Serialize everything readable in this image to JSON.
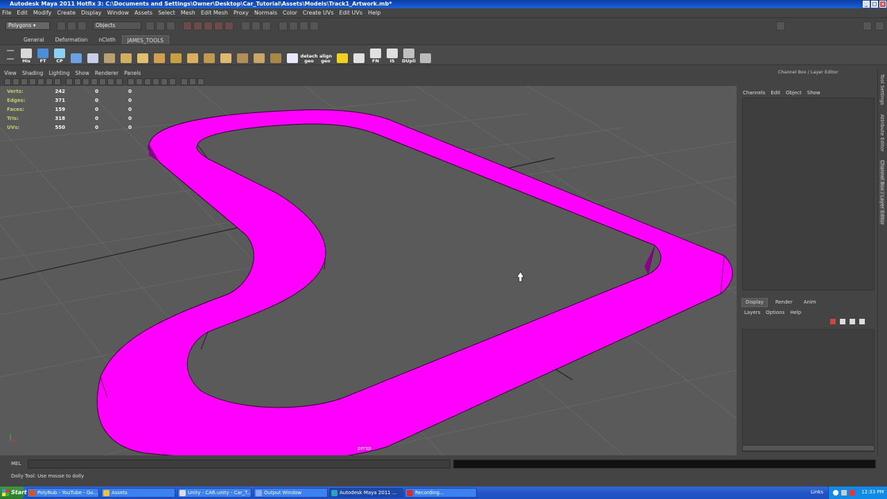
{
  "window": {
    "title": "Autodesk Maya 2011 Hotfix 3: C:\\Documents and Settings\\Owner\\Desktop\\Car_Tutorial\\Assets\\Models\\Track1_Artwork.mb*"
  },
  "menubar": {
    "items": [
      "File",
      "Edit",
      "Modify",
      "Create",
      "Display",
      "Window",
      "Assets",
      "Select",
      "Mesh",
      "Edit Mesh",
      "Proxy",
      "Normals",
      "Color",
      "Create UVs",
      "Edit UVs",
      "Help"
    ]
  },
  "statusline": {
    "mode": "Polygons",
    "selection_field": "Objects"
  },
  "shelf": {
    "tabs": [
      "General",
      "Deformation",
      "nCloth",
      "JAMES_TOOLS"
    ],
    "active_tab": "JAMES_TOOLS",
    "icons": [
      {
        "name": "his-icon",
        "label": "His",
        "color": "#d8d8d8"
      },
      {
        "name": "ft-icon",
        "label": "FT",
        "color": "#4a8fd8"
      },
      {
        "name": "cp-icon",
        "label": "CP",
        "color": "#8bd1f1"
      },
      {
        "name": "cube-icon",
        "label": "",
        "color": "#6da0e0"
      },
      {
        "name": "cone-icon",
        "label": "",
        "color": "#c8d0e8"
      },
      {
        "name": "extrude-icon",
        "label": "",
        "color": "#b8a070"
      },
      {
        "name": "uv-icon-1",
        "label": "",
        "color": "#d0b060"
      },
      {
        "name": "uv-icon-2",
        "label": "",
        "color": "#e0c070"
      },
      {
        "name": "uv-icon-3",
        "label": "",
        "color": "#d0a050"
      },
      {
        "name": "uv-icon-4",
        "label": "",
        "color": "#c8a040"
      },
      {
        "name": "uv-icon-5",
        "label": "",
        "color": "#d8b060"
      },
      {
        "name": "uv-icon-6",
        "label": "",
        "color": "#c09850"
      },
      {
        "name": "uv-icon-7",
        "label": "",
        "color": "#e0b870"
      },
      {
        "name": "plane-icon",
        "label": "",
        "color": "#b09058"
      },
      {
        "name": "unfold-icon",
        "label": "",
        "color": "#c8a868"
      },
      {
        "name": "pin-icon",
        "label": "",
        "color": "#a88848"
      },
      {
        "name": "light-icon",
        "label": "",
        "color": "#e8e8ff"
      },
      {
        "name": "detach-geo-icon",
        "label": "detach geo",
        "color": "#4a4a4a"
      },
      {
        "name": "align-geo-icon",
        "label": "align geo",
        "color": "#4a4a4a"
      },
      {
        "name": "key-icon",
        "label": "",
        "color": "#f0d020"
      },
      {
        "name": "unity-icon",
        "label": "",
        "color": "#e0e0e0"
      },
      {
        "name": "fn-icon",
        "label": "FN",
        "color": "#e0e0e0"
      },
      {
        "name": "is-icon",
        "label": "IS",
        "color": "#e0e0e0"
      },
      {
        "name": "dupli-icon",
        "label": "DUpli",
        "color": "#c0c0c0"
      },
      {
        "name": "tool-icon",
        "label": "",
        "color": "#bbbbbb"
      }
    ]
  },
  "viewport": {
    "menu": [
      "View",
      "Shading",
      "Lighting",
      "Show",
      "Renderer",
      "Panels"
    ],
    "camera_label": "persp",
    "hud": [
      {
        "label": "Verts:",
        "values": [
          "242",
          "0",
          "0"
        ]
      },
      {
        "label": "Edges:",
        "values": [
          "371",
          "0",
          "0"
        ]
      },
      {
        "label": "Faces:",
        "values": [
          "159",
          "0",
          "0"
        ]
      },
      {
        "label": "Tris:",
        "values": [
          "318",
          "0",
          "0"
        ]
      },
      {
        "label": "UVs:",
        "values": [
          "550",
          "0",
          "0"
        ]
      }
    ],
    "mesh_color": "#ff00ff",
    "background_color": "#5a5a5a"
  },
  "channel_box": {
    "title": "Channel Box / Layer Editor",
    "menu": [
      "Channels",
      "Edit",
      "Object",
      "Show"
    ],
    "layer_tabs": [
      "Display",
      "Render",
      "Anim"
    ],
    "active_layer_tab": "Display",
    "layer_menu": [
      "Layers",
      "Options",
      "Help"
    ]
  },
  "side_tabs": [
    "Tool Settings",
    "Attribute Editor",
    "Channel Box / Layer Editor"
  ],
  "commandline": {
    "label": "MEL"
  },
  "helpline": {
    "text": "Dolly Tool: Use mouse to dolly"
  },
  "taskbar": {
    "start": "Start",
    "tasks": [
      {
        "label": "PolyNub - YouTube - Go...",
        "color": "#e05020"
      },
      {
        "label": "Assets",
        "color": "#f0c040"
      },
      {
        "label": "Unity - CAR.unity - Car_T...",
        "color": "#dddddd"
      },
      {
        "label": "Output Window",
        "color": "#88aaff"
      },
      {
        "label": "Autodesk Maya 2011 ...",
        "color": "#30a0c0",
        "active": true
      },
      {
        "label": "Recording...",
        "color": "#d03030"
      }
    ],
    "links": "Links",
    "clock": "12:33 PM"
  }
}
